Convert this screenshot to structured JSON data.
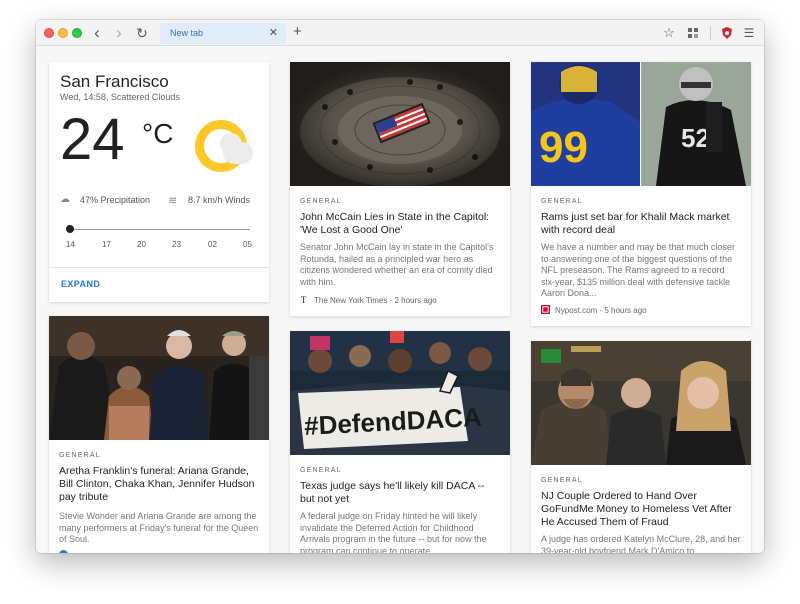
{
  "browser": {
    "tab_title": "New tab",
    "tab_close": "✕",
    "new_tab": "+",
    "back": "‹",
    "forward": "›",
    "reload": "↻",
    "bookmark": "☆",
    "menu": "☰"
  },
  "weather": {
    "city": "San Francisco",
    "subtitle": "Wed, 14:58, Scattered Clouds",
    "temperature": "24",
    "unit": "°C",
    "precipitation": "47% Precipitation",
    "winds": "8.7 km/h Winds",
    "hours": [
      "14",
      "17",
      "20",
      "23",
      "02",
      "05"
    ],
    "expand": "EXPAND"
  },
  "cards": [
    {
      "category": "GENERAL",
      "headline": "John McCain Lies in State in the Capitol: 'We Lost a Good One'",
      "excerpt": "Senator John McCain lay in state in the Capitol's Rotunda, hailed as a principled war hero as citizens wondered whether an era of comity died with him.",
      "source": "The New York Times · 2 hours ago"
    },
    {
      "category": "GENERAL",
      "headline": "Rams just set bar for Khalil Mack market with record deal",
      "excerpt": "We have a number and may be that much closer to answering one of the biggest questions of the NFL preseason. The Rams agreed to a record six-year, $135 million deal with defensive tackle Aaron Dona...",
      "source": "Nypost.com · 5 hours ago"
    },
    {
      "category": "GENERAL",
      "headline": "Aretha Franklin's funeral: Ariana Grande, Bill Clinton, Chaka Khan, Jennifer Hudson pay tribute",
      "excerpt": "Stevie Wonder and Ariana Grande are among the many performers at Friday's funeral for the Queen of Soul."
    },
    {
      "category": "GENERAL",
      "headline": "Texas judge says he'll likely kill DACA -- but not yet",
      "excerpt": "A federal judge on Friday hinted he will likely invalidate the Deferred Action for Childhood Arrivals program in the future -- but for now the program can continue to operate."
    },
    {
      "category": "GENERAL",
      "headline": "NJ Couple Ordered to Hand Over GoFundMe Money to Homeless Vet After He Accused Them of Fraud",
      "excerpt": "A judge has ordered Katelyn McClure, 28, and her 39-year-old boyfriend Mark D'Amico to"
    }
  ],
  "image_text": {
    "jersey_99": "99",
    "jersey_52": "52",
    "banner": "#DefendDACA"
  },
  "colors": {
    "accent": "#1f7bd8",
    "sun": "#fcc829",
    "rams_blue": "#1f3ea0",
    "rams_gold": "#f5c518"
  }
}
